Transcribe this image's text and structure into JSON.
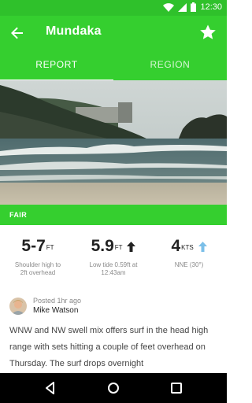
{
  "status_bar": {
    "time": "12:30"
  },
  "header": {
    "title": "Mundaka"
  },
  "tabs": [
    {
      "label": "REPORT",
      "active": true
    },
    {
      "label": "REGION",
      "active": false
    }
  ],
  "rating": {
    "label": "FAIR"
  },
  "stats": {
    "wave": {
      "value": "5-7",
      "unit": "FT",
      "caption_line1": "Shoulder high to",
      "caption_line2": "2ft overhead"
    },
    "tide": {
      "value": "5.9",
      "unit": "FT",
      "direction": "rising",
      "caption_line1": "Low tide 0.59ft at",
      "caption_line2": "12:43am"
    },
    "wind": {
      "value": "4",
      "unit": "KTS",
      "caption_line1": "NNE (30°)"
    }
  },
  "post": {
    "posted": "Posted 1hr ago",
    "author": "Mike Watson",
    "text": "WNW and NW swell mix offers surf in the head high range with sets hitting a couple of feet overhead on Thursday. The surf drops overnight"
  },
  "colors": {
    "accent": "#35cf2f",
    "status": "#2fc12b",
    "wind_arrow": "#7bbfe8"
  }
}
